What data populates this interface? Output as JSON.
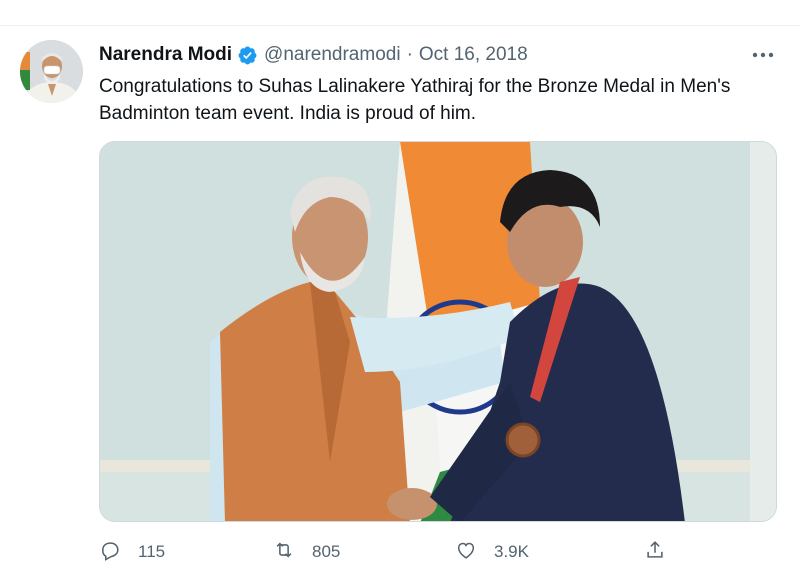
{
  "tweet": {
    "author_name": "Narendra Modi",
    "handle": "@narendramodi",
    "separator": "·",
    "date": "Oct 16, 2018",
    "text": "Congratulations to Suhas Lalinakere Yathiraj for the Bronze Medal in Men's Badminton team event. India is proud of him."
  },
  "actions": {
    "replies": "115",
    "retweets": "805",
    "likes": "3.9K"
  },
  "icons": {
    "verified": "verified-badge-icon",
    "more": "more-options-icon",
    "reply": "reply-icon",
    "retweet": "retweet-icon",
    "like": "heart-icon",
    "share": "share-icon"
  },
  "colors": {
    "verified_blue": "#1d9bf0",
    "secondary_text": "#536471",
    "primary_text": "#0f1419"
  }
}
